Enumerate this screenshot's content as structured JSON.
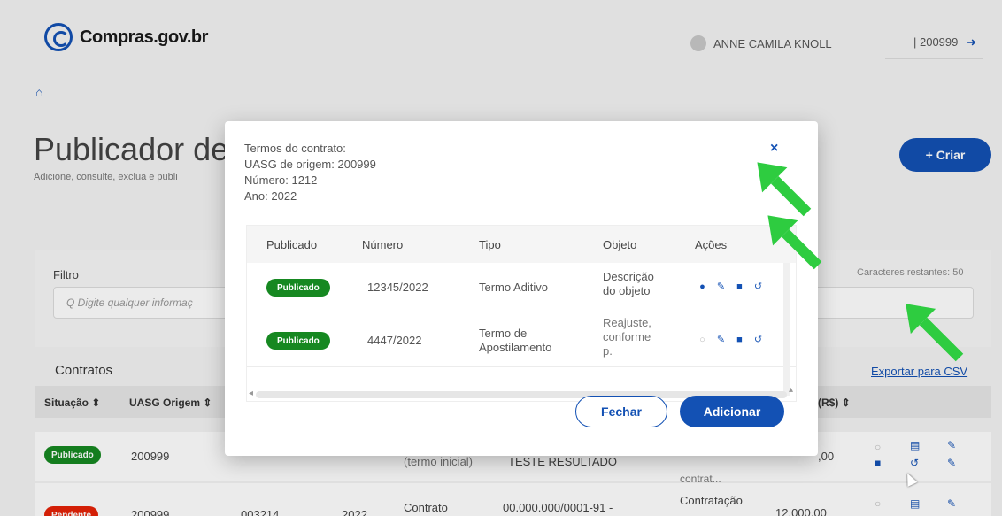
{
  "app": {
    "logo_text": "Compras.gov.br"
  },
  "header": {
    "user_name": "ANNE CAMILA KNOLL",
    "uasg": "| 200999"
  },
  "page": {
    "title": "Publicador de",
    "subtitle": "Adicione, consulte, exclua e publi",
    "create_label": "+ Criar"
  },
  "filter": {
    "label": "Filtro",
    "placeholder": "Q  Digite qualquer informaç",
    "chars_left": "Caracteres restantes: 50"
  },
  "contratos": {
    "title": "Contratos",
    "export_label": "Exportar para CSV",
    "columns": [
      "Situação ⇕",
      "UASG Origem ⇕",
      "(R$) ⇕"
    ],
    "rows": [
      {
        "status": "Publicado",
        "status_color": "#168821",
        "uasg": "200999",
        "tipo": "(termo inicial)",
        "objeto": "TESTE RESULTADO",
        "extra": "contrat...",
        "valor": ",00"
      },
      {
        "status": "Pendente",
        "status_color": "#e52207",
        "uasg": "200999",
        "numero": "003214",
        "ano": "2022",
        "tipo": "Contrato",
        "objeto": "00.000.000/0001-91 -",
        "extra": "Contratação",
        "valor": "12.000,00"
      }
    ]
  },
  "modal": {
    "info": {
      "line1": "Termos do contrato:",
      "line2": "UASG de origem: 200999",
      "line3": "Número: 1212",
      "line4": "Ano: 2022"
    },
    "close_icon": "×",
    "columns": [
      "Publicado",
      "Número",
      "Tipo",
      "Objeto",
      "Ações"
    ],
    "rows": [
      {
        "status": "Publicado",
        "numero": "12345/2022",
        "tipo": "Termo Aditivo",
        "objeto_l1": "Descrição",
        "objeto_l2": "do objeto",
        "objeto_l3": ""
      },
      {
        "status": "Publicado",
        "numero": "4447/2022",
        "tipo_l1": "Termo de",
        "tipo_l2": "Apostilamento",
        "objeto_l1": "Reajuste,",
        "objeto_l2": "conforme",
        "objeto_l3": "p."
      }
    ],
    "buttons": {
      "close": "Fechar",
      "add": "Adicionar"
    }
  },
  "colors": {
    "primary": "#1351b4",
    "success": "#168821",
    "danger": "#e52207",
    "arrow": "#2ecc40"
  }
}
